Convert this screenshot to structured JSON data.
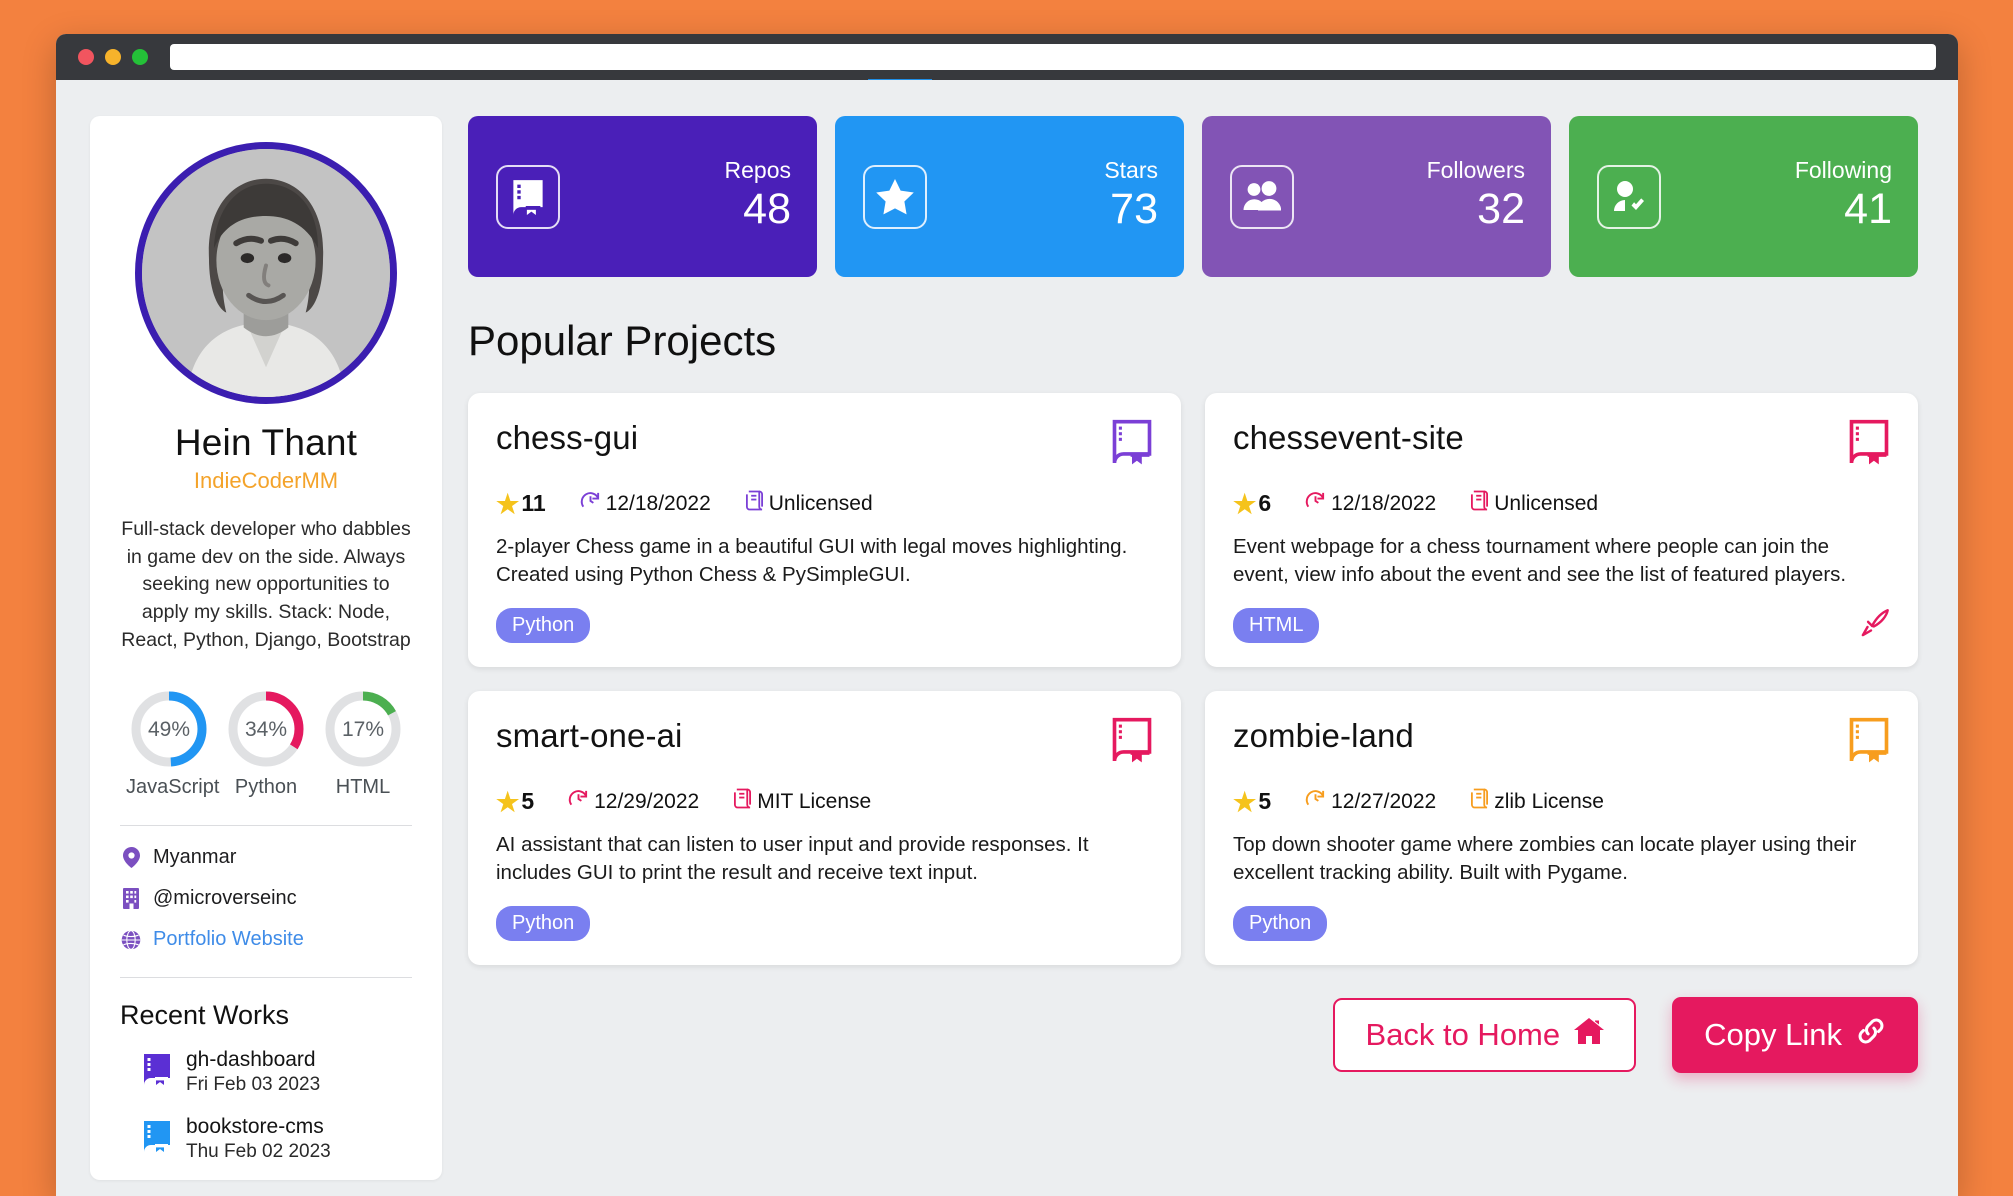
{
  "browser": {
    "url_value": "",
    "url_placeholder": "",
    "traffic_lights": [
      "close",
      "minimize",
      "maximize"
    ]
  },
  "profile": {
    "name": "Hein Thant",
    "handle": "IndieCoderMM",
    "bio": "Full-stack developer who dabbles in game dev on the side. Always seeking new opportunities to apply my skills. Stack: Node, React, Python, Django, Bootstrap",
    "avatar_alt": "profile-photo",
    "languages": [
      {
        "label": "JavaScript",
        "percent": 49,
        "percent_text": "49%",
        "color": "#2196f3"
      },
      {
        "label": "Python",
        "percent": 34,
        "percent_text": "34%",
        "color": "#e5195f"
      },
      {
        "label": "HTML",
        "percent": 17,
        "percent_text": "17%",
        "color": "#4caf50"
      }
    ],
    "info": [
      {
        "icon": "location-pin-icon",
        "text": "Myanmar",
        "is_link": false
      },
      {
        "icon": "building-icon",
        "text": "@microverseinc",
        "is_link": false
      },
      {
        "icon": "globe-icon",
        "text": "Portfolio Website",
        "is_link": true
      }
    ],
    "recent_works_title": "Recent Works",
    "recent_works": [
      {
        "name": "gh-dashboard",
        "date": "Fri Feb 03 2023",
        "icon": "book-icon",
        "color": "#5b2fd4"
      },
      {
        "name": "bookstore-cms",
        "date": "Thu Feb 02 2023",
        "icon": "book-icon",
        "color": "#2196f3"
      }
    ]
  },
  "stats": [
    {
      "label": "Repos",
      "value": "48",
      "icon": "book-icon",
      "bg": "#4a1fb8"
    },
    {
      "label": "Stars",
      "value": "73",
      "icon": "star-icon",
      "bg": "#2196f3"
    },
    {
      "label": "Followers",
      "value": "32",
      "icon": "people-icon",
      "bg": "#8254b5"
    },
    {
      "label": "Following",
      "value": "41",
      "icon": "person-check-icon",
      "bg": "#4caf50"
    }
  ],
  "projects_section_title": "Popular Projects",
  "projects": [
    {
      "title": "chess-gui",
      "stars": "11",
      "date": "12/18/2022",
      "license": "Unlicensed",
      "description": "2-player Chess game in a beautiful GUI with legal moves highlighting. Created using Python Chess & PySimpleGUI.",
      "language": "Python",
      "accent": "#7b3fd6",
      "has_demo_link": false,
      "demo_icon": "rocket-icon"
    },
    {
      "title": "chessevent-site",
      "stars": "6",
      "date": "12/18/2022",
      "license": "Unlicensed",
      "description": "Event webpage for a chess tournament where people can join the event, view info about the event and see the list of featured players.",
      "language": "HTML",
      "accent": "#e5195f",
      "has_demo_link": true,
      "demo_icon": "rocket-icon"
    },
    {
      "title": "smart-one-ai",
      "stars": "5",
      "date": "12/29/2022",
      "license": "MIT License",
      "description": "AI assistant that can listen to user input and provide responses. It includes GUI to print the result and receive text input.",
      "language": "Python",
      "accent": "#e5195f",
      "has_demo_link": false,
      "demo_icon": "rocket-icon"
    },
    {
      "title": "zombie-land",
      "stars": "5",
      "date": "12/27/2022",
      "license": "zlib License",
      "description": "Top down shooter game where zombies can locate player using their excellent tracking ability. Built with Pygame.",
      "language": "Python",
      "accent": "#f79d1e",
      "has_demo_link": false,
      "demo_icon": "rocket-icon"
    }
  ],
  "actions": {
    "back_label": "Back to Home",
    "back_icon": "home-icon",
    "copy_label": "Copy Link",
    "copy_icon": "link-icon"
  },
  "colors": {
    "page_background": "#f3813f",
    "app_background": "#eceef0",
    "accent_pink": "#e5195f",
    "accent_purple": "#4a1fb8",
    "handle_orange": "#f4a32a"
  }
}
